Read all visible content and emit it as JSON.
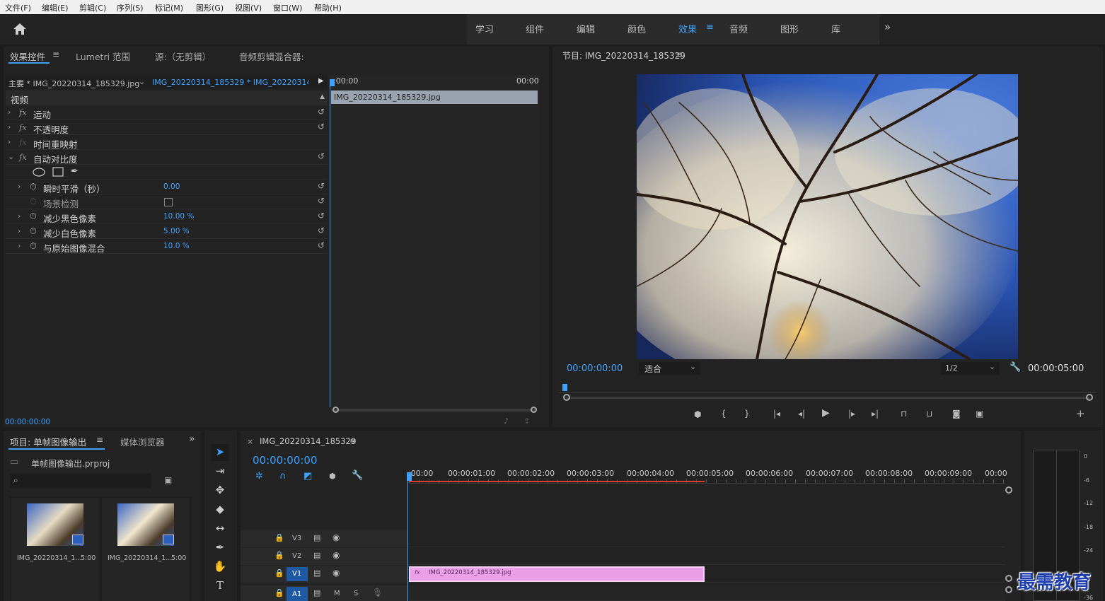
{
  "menu": [
    "文件(F)",
    "编辑(E)",
    "剪辑(C)",
    "序列(S)",
    "标记(M)",
    "图形(G)",
    "视图(V)",
    "窗口(W)",
    "帮助(H)"
  ],
  "workspaces": [
    "学习",
    "组件",
    "编辑",
    "颜色",
    "效果",
    "音频",
    "图形",
    "库"
  ],
  "workspace_active": "效果",
  "effect_panel": {
    "tabs": [
      "效果控件",
      "Lumetri 范围",
      "源:（无剪辑）",
      "音频剪辑混合器:"
    ],
    "master_clip": "主要 * IMG_20220314_185329.jpg",
    "sequence_clip": "IMG_20220314_185329 * IMG_20220314_...",
    "time_start": ":00:00",
    "time_end": "00:00",
    "clip_label": "IMG_20220314_185329.jpg",
    "section": "视频",
    "effects": [
      "运动",
      "不透明度",
      "时间重映射",
      "自动对比度"
    ],
    "params": [
      {
        "name": "瞬时平滑（秒）",
        "value": "0.00"
      },
      {
        "name": "场景检测",
        "value": ""
      },
      {
        "name": "减少黑色像素",
        "value": "10.00 %"
      },
      {
        "name": "减少白色像素",
        "value": "5.00 %"
      },
      {
        "name": "与原始图像混合",
        "value": "10.0 %"
      }
    ],
    "timecode": "00:00:00:00"
  },
  "program": {
    "title": "节目: IMG_20220314_185329",
    "timecode": "00:00:00:00",
    "fit": "适合",
    "resolution": "1/2",
    "duration": "00:00:05:00"
  },
  "project": {
    "tabs": [
      "项目: 单帧图像输出",
      "媒体浏览器"
    ],
    "file": "单帧图像输出.prproj",
    "items": [
      {
        "name": "IMG_20220314_1...",
        "duration": "5:00"
      },
      {
        "name": "IMG_20220314_1...",
        "duration": "5:00"
      }
    ]
  },
  "timeline": {
    "sequence": "IMG_20220314_185329",
    "timecode": "00:00:00:00",
    "ruler": [
      ":00:00",
      "00:00:01:00",
      "00:00:02:00",
      "00:00:03:00",
      "00:00:04:00",
      "00:00:05:00",
      "00:00:06:00",
      "00:00:07:00",
      "00:00:08:00",
      "00:00:09:00",
      "00:00"
    ],
    "tracks": [
      "V3",
      "V2",
      "V1",
      "A1"
    ],
    "clip": "IMG_20220314_185329.jpg",
    "audio_flags": [
      "M",
      "S"
    ]
  },
  "meter_scale": [
    "0",
    "-6",
    "-12",
    "-18",
    "-24",
    "-36"
  ],
  "watermark": "最需教育"
}
